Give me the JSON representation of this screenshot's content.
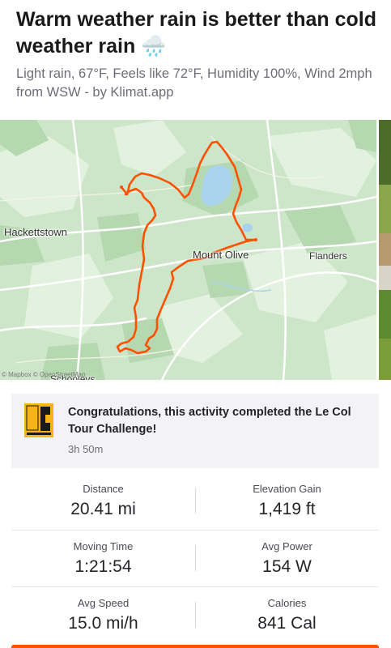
{
  "activity": {
    "title": "Warm weather rain is better than cold weather rain 🌧️",
    "description": "Light rain, 67°F, Feels like 72°F, Humidity 100%, Wind 2mph from WSW - by Klimat.app"
  },
  "map": {
    "labels": {
      "hackettstown": "Hackettstown",
      "mount_olive": "Mount Olive",
      "flanders": "Flanders",
      "schooleys": "Schooleys"
    },
    "attribution": "© Mapbox © OpenStreetMap",
    "route_color": "#fc5200",
    "water_color": "#a9d3ec"
  },
  "achievement": {
    "badge_text": "LE COL",
    "title": "Congratulations, this activity completed the Le Col Tour Challenge!",
    "duration": "3h 50m"
  },
  "stats": [
    {
      "label": "Distance",
      "value": "20.41 mi"
    },
    {
      "label": "Elevation Gain",
      "value": "1,419 ft"
    },
    {
      "label": "Moving Time",
      "value": "1:21:54"
    },
    {
      "label": "Avg Power",
      "value": "154 W"
    },
    {
      "label": "Avg Speed",
      "value": "15.0 mi/h"
    },
    {
      "label": "Calories",
      "value": "841 Cal"
    }
  ],
  "colors": {
    "accent": "#fc5200",
    "text_primary": "#242428",
    "text_secondary": "#6d6d78",
    "card_bg": "#f3f3f5"
  }
}
